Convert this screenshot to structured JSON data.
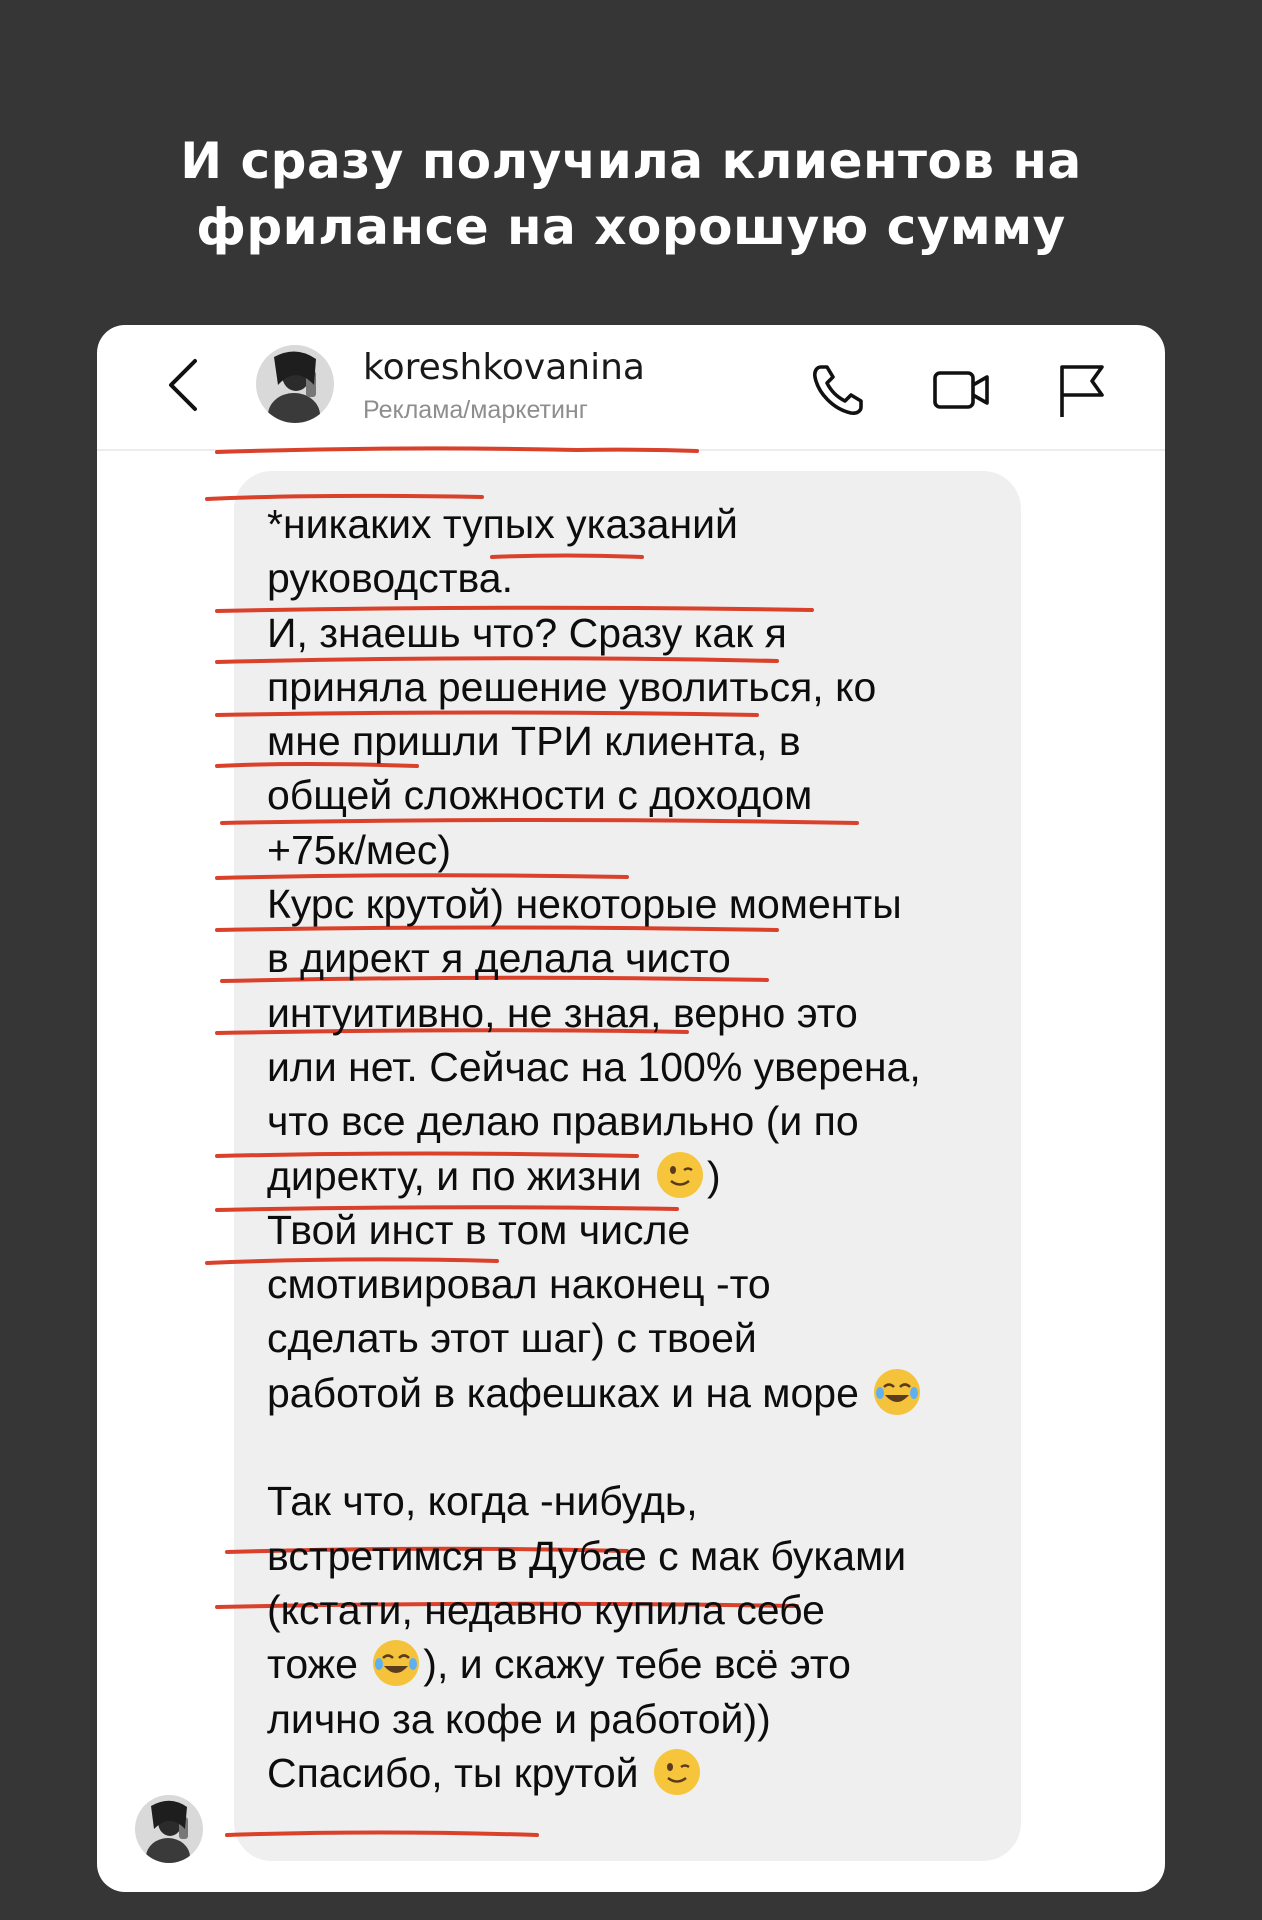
{
  "headline": {
    "line1": "И сразу получила клиентов на",
    "line2": "фрилансе на хорошую сумму"
  },
  "chat_header": {
    "username": "koreshkovanina",
    "subtitle": "Реклама/маркетинг",
    "icons": [
      "back-chevron-icon",
      "phone-icon",
      "video-camera-icon",
      "flag-icon"
    ]
  },
  "message": {
    "lines": [
      "*никаких тупых указаний",
      "руководства.",
      "И, знаешь что? Сразу как я",
      "приняла решение уволиться, ко",
      "мне пришли ТРИ клиента, в",
      "общей сложности с доходом",
      "+75к/мес)",
      "Курс крутой) некоторые моменты",
      "в директ я делала чисто",
      "интуитивно, не зная, верно это",
      "или нет. Сейчас на 100% уверена,",
      "что все делаю правильно (и по",
      "директу, и по жизни",
      ")",
      "Твой инст в том числе",
      "смотивировал наконец -то",
      "сделать этот шаг) с твоей",
      "работой в кафешках и на море",
      "",
      "Так что, когда -нибудь,",
      "встретимся в Дубае с мак буками",
      "(кстати, недавно купила себе",
      "тоже",
      "), и скажу тебе всё это",
      "лично за кофе и работой))",
      "Спасибо, ты крутой"
    ],
    "emoji": [
      "winking-face",
      "tears-of-joy-face",
      "tears-of-joy-face",
      "winking-face"
    ]
  }
}
